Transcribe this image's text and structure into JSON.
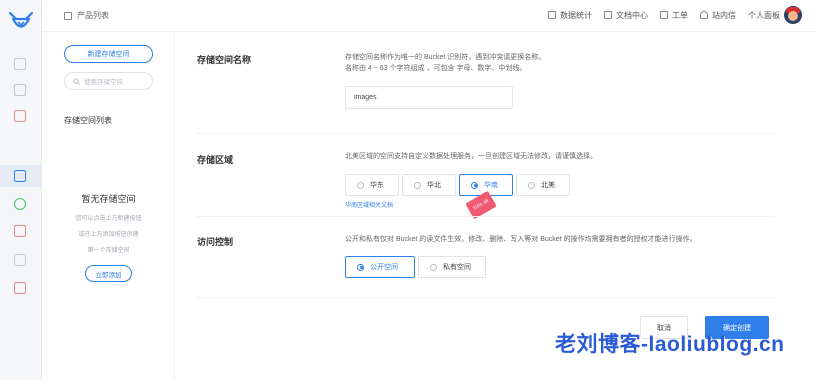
{
  "header": {
    "breadcrumb": "产品列表",
    "nav": [
      "数据统计",
      "文档中心",
      "工单",
      "站内信",
      "个人面板"
    ]
  },
  "sidebar": {
    "new_button": "新建存储空间",
    "search_placeholder": "搜索存储空间",
    "list_title": "存储空间列表",
    "empty_title": "暂无存储空间",
    "empty_lines": [
      "您可以点击上方新建按钮",
      "或在上方添加按钮创建",
      "第一个存储空间"
    ],
    "add_button": "立即添加"
  },
  "form": {
    "name": {
      "label": "存储空间名称",
      "desc": [
        "存储空间名称作为唯一的 Bucket 识别符，遇到冲突请更换名称。",
        "名称由 4 ~ 63 个字符组成 ，可包含 字母、数字、中划线。"
      ],
      "value": "images"
    },
    "region": {
      "label": "存储区域",
      "desc": "北美区域的空间支持自定义数据处理服务，一旦创建区域无法修改，请谨慎选择。",
      "options": [
        "华东",
        "华北",
        "华南",
        "北美"
      ],
      "selected": "华南",
      "doc_link": "华南区域相关文档",
      "promo_badge": "10% off"
    },
    "access": {
      "label": "访问控制",
      "desc": "公开和私有仅对 Bucket 的读文件生效，修改、删除、写入等对 Bucket 的操作均需要拥有者的授权才能进行操作。",
      "options": [
        "公开空间",
        "私有空间"
      ],
      "selected": "公开空间"
    },
    "cancel": "取消",
    "submit": "确定创建"
  },
  "watermark": "老刘博客-laoliublog.cn",
  "colors": {
    "accent": "#2f7ee9",
    "watermark": "#2a5ad6",
    "promo": "#ef5a72"
  }
}
